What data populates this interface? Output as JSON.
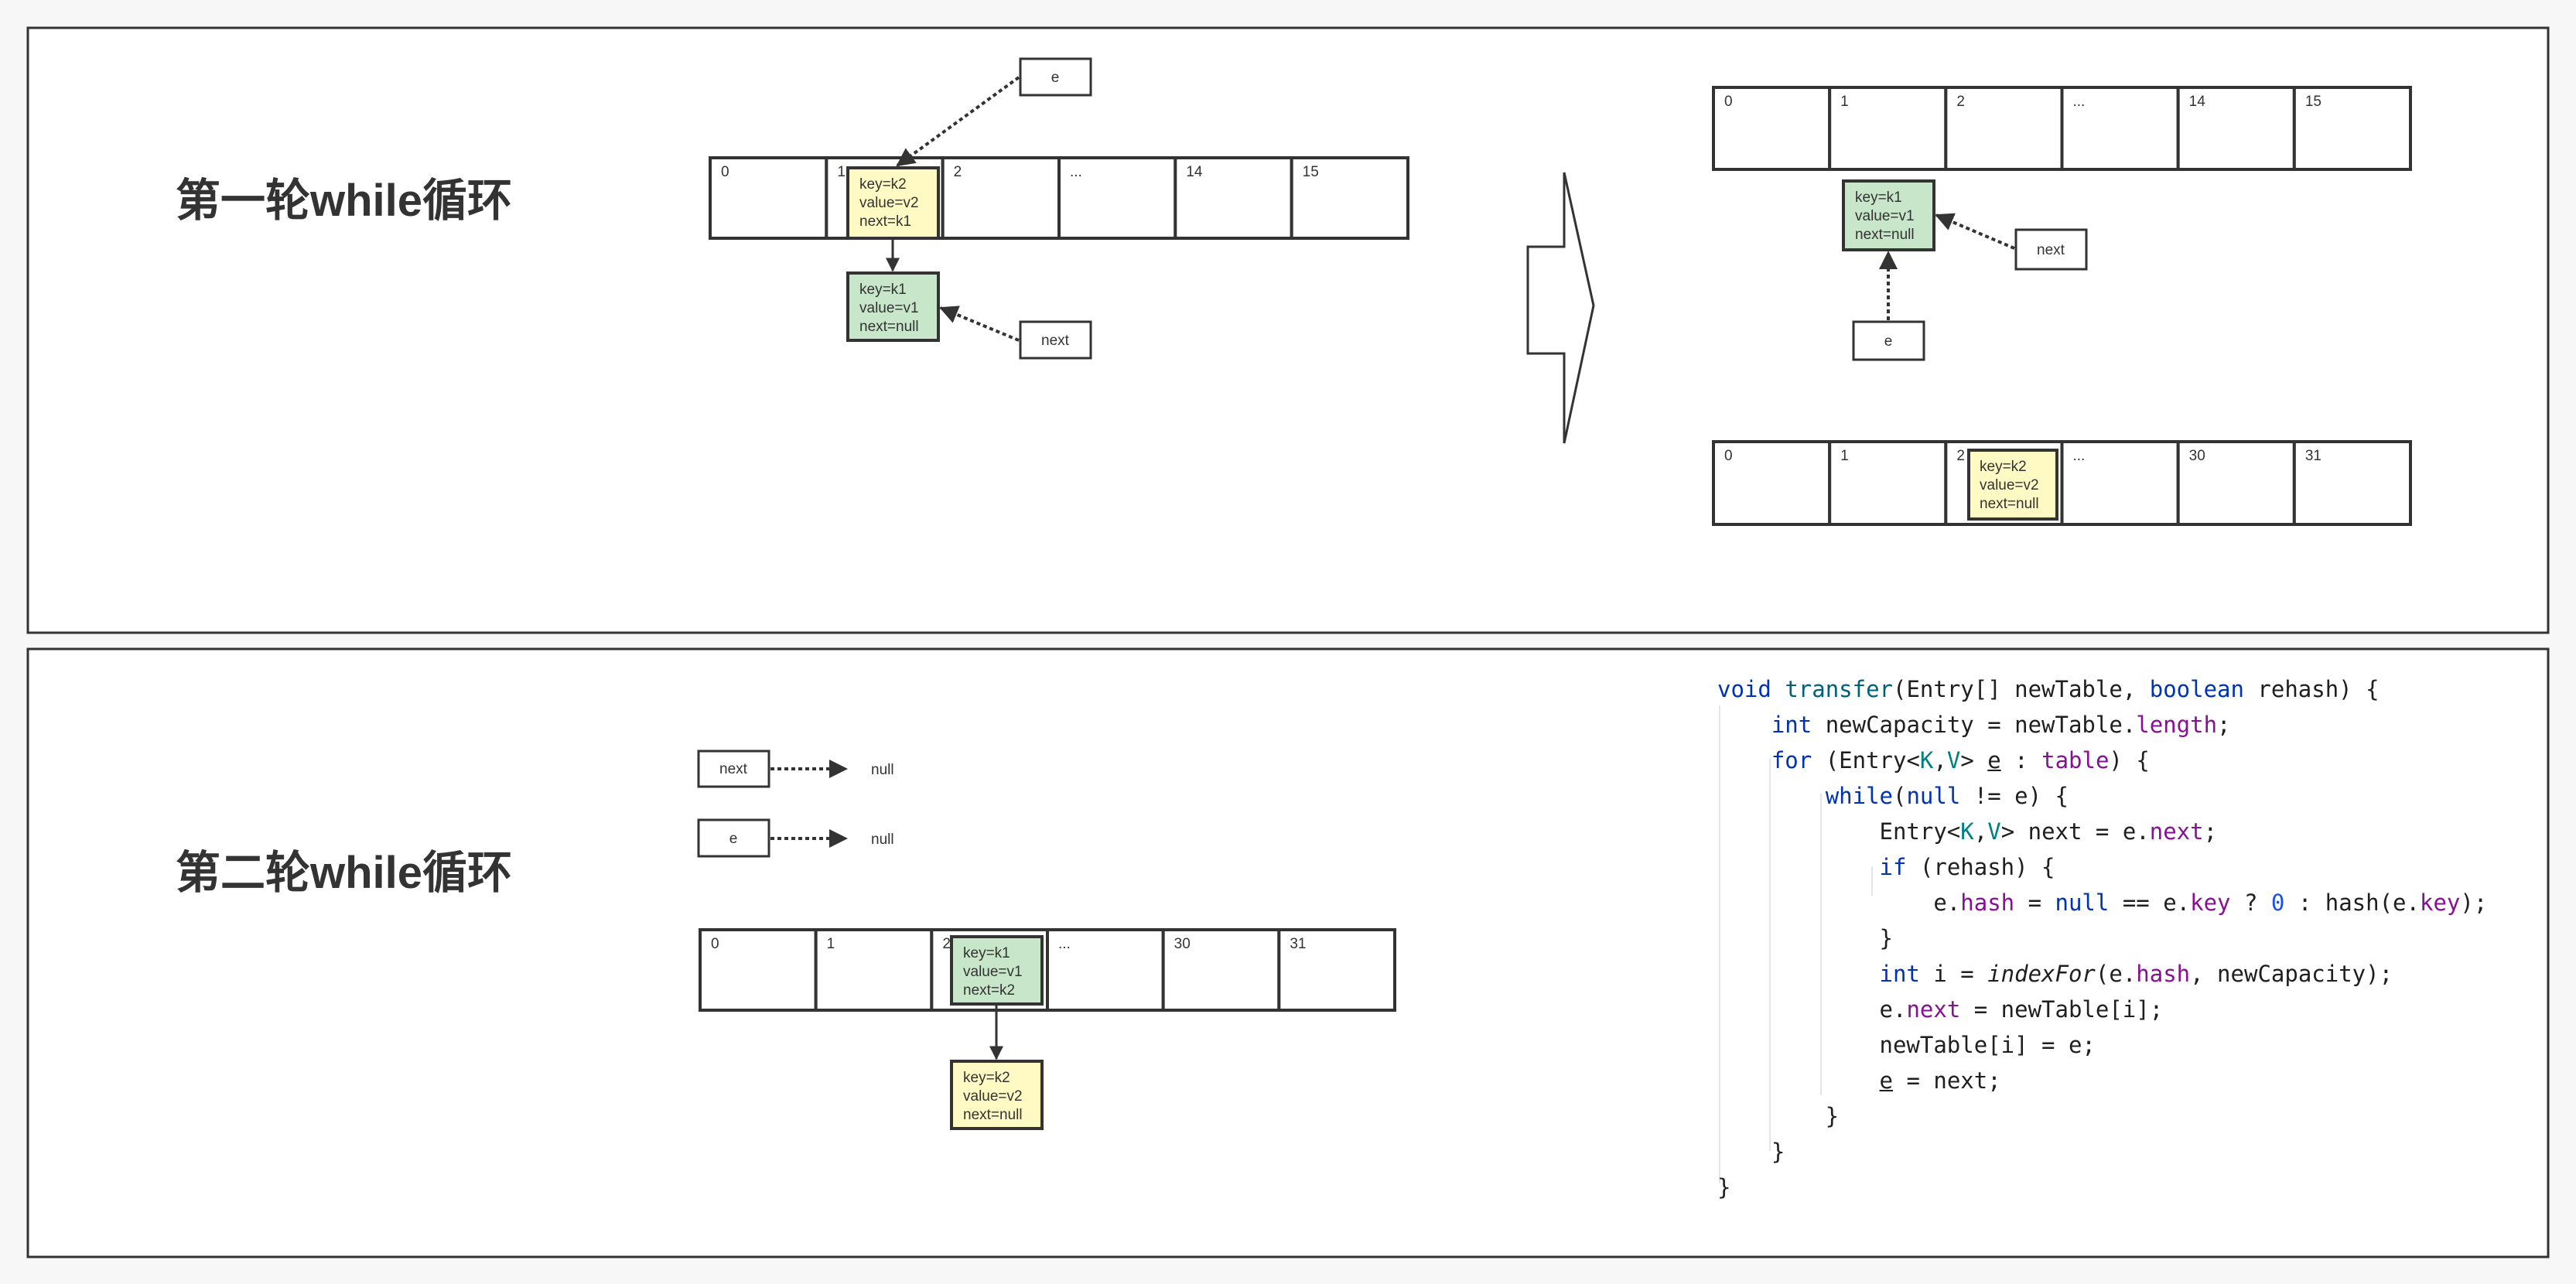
{
  "round1": {
    "title": "第一轮while循环",
    "before": {
      "indices": [
        "0",
        "1",
        "2",
        "...",
        "14",
        "15"
      ],
      "node_yellow": [
        "key=k2",
        "value=v2",
        "next=k1"
      ],
      "node_green": [
        "key=k1",
        "value=v1",
        "next=null"
      ],
      "e_label": "e",
      "next_label": "next"
    },
    "after": {
      "old_indices": [
        "0",
        "1",
        "2",
        "...",
        "14",
        "15"
      ],
      "node_green": [
        "key=k1",
        "value=v1",
        "next=null"
      ],
      "next_label": "next",
      "e_label": "e",
      "new_indices": [
        "0",
        "1",
        "2",
        "...",
        "30",
        "31"
      ],
      "node_yellow": [
        "key=k2",
        "value=v2",
        "next=null"
      ]
    }
  },
  "round2": {
    "title": "第二轮while循环",
    "next_label": "next",
    "next_null": "null",
    "e_label": "e",
    "e_null": "null",
    "indices": [
      "0",
      "1",
      "2",
      "...",
      "30",
      "31"
    ],
    "node_green": [
      "key=k1",
      "value=v1",
      "next=k2"
    ],
    "node_yellow": [
      "key=k2",
      "value=v2",
      "next=null"
    ]
  },
  "code": [
    [
      [
        "kw",
        "void "
      ],
      [
        "fn",
        "transfer"
      ],
      [
        "",
        "(Entry[] newTable, "
      ],
      [
        "kw",
        "boolean"
      ],
      [
        "",
        " rehash) {"
      ]
    ],
    [
      [
        "",
        "    "
      ],
      [
        "kw",
        "int"
      ],
      [
        "",
        " newCapacity = newTable."
      ],
      [
        "fld",
        "length"
      ],
      [
        "",
        ";"
      ]
    ],
    [
      [
        "",
        "    "
      ],
      [
        "kw",
        "for"
      ],
      [
        "",
        " (Entry<"
      ],
      [
        "tp",
        "K"
      ],
      [
        "",
        ","
      ],
      [
        "tp",
        "V"
      ],
      [
        "",
        "> "
      ],
      [
        "ul",
        "e"
      ],
      [
        "",
        " : "
      ],
      [
        "fld",
        "table"
      ],
      [
        "",
        ") {"
      ]
    ],
    [
      [
        "",
        "        "
      ],
      [
        "kw",
        "while"
      ],
      [
        "",
        "("
      ],
      [
        "kw",
        "null"
      ],
      [
        "",
        " != e) {"
      ]
    ],
    [
      [
        "",
        "            Entry<"
      ],
      [
        "tp",
        "K"
      ],
      [
        "",
        ","
      ],
      [
        "tp",
        "V"
      ],
      [
        "",
        "> next = e."
      ],
      [
        "fld",
        "next"
      ],
      [
        "",
        ";"
      ]
    ],
    [
      [
        "",
        "            "
      ],
      [
        "kw",
        "if"
      ],
      [
        "",
        " (rehash) {"
      ]
    ],
    [
      [
        "",
        "                e."
      ],
      [
        "fld",
        "hash"
      ],
      [
        "",
        " = "
      ],
      [
        "kw",
        "null"
      ],
      [
        "",
        " == e."
      ],
      [
        "fld",
        "key"
      ],
      [
        "",
        " ? "
      ],
      [
        "num",
        "0"
      ],
      [
        "",
        " : hash(e."
      ],
      [
        "fld",
        "key"
      ],
      [
        "",
        ");"
      ]
    ],
    [
      [
        "",
        "            }"
      ]
    ],
    [
      [
        "",
        "            "
      ],
      [
        "kw",
        "int"
      ],
      [
        "",
        " i = "
      ],
      [
        "it",
        "indexFor"
      ],
      [
        "",
        "(e."
      ],
      [
        "fld",
        "hash"
      ],
      [
        "",
        ", newCapacity);"
      ]
    ],
    [
      [
        "",
        "            e."
      ],
      [
        "fld",
        "next"
      ],
      [
        "",
        " = newTable[i];"
      ]
    ],
    [
      [
        "",
        "            newTable[i] = e;"
      ]
    ],
    [
      [
        "",
        "            "
      ],
      [
        "ul",
        "e"
      ],
      [
        "",
        " = next;"
      ]
    ],
    [
      [
        "",
        "        }"
      ]
    ],
    [
      [
        "",
        "    }"
      ]
    ],
    [
      [
        "",
        "}"
      ]
    ]
  ]
}
